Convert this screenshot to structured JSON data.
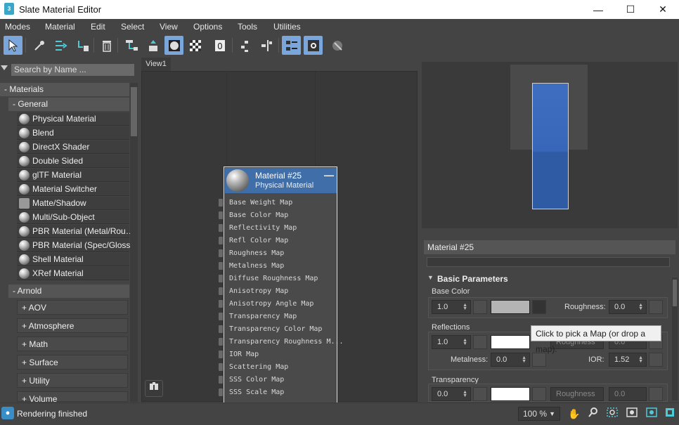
{
  "window": {
    "title": "Slate Material Editor",
    "app_icon": "3",
    "minimize": "—",
    "maximize": "☐",
    "close": "✕"
  },
  "menu": [
    "Modes",
    "Material",
    "Edit",
    "Select",
    "View",
    "Options",
    "Tools",
    "Utilities"
  ],
  "search": {
    "placeholder": "Search by Name ..."
  },
  "browser": {
    "materials_header": "- Materials",
    "general_header": "- General",
    "general_items": [
      "Physical Material",
      "Blend",
      "DirectX Shader",
      "Double Sided",
      "glTF Material",
      "Material Switcher",
      "Matte/Shadow",
      "Multi/Sub-Object",
      "PBR Material (Metal/Rou…",
      "PBR Material (Spec/Gloss)",
      "Shell Material",
      "XRef Material"
    ],
    "arnold_header": "- Arnold",
    "arnold_subcats": [
      "+ AOV",
      "+ Atmosphere",
      "+ Math",
      "+ Surface",
      "+ Utility",
      "+ Volume"
    ]
  },
  "view": {
    "tab": "View1"
  },
  "node": {
    "title": "Material #25",
    "subtitle": "Physical Material",
    "minimize": "—",
    "slots": [
      "Base Weight Map",
      "Base Color Map",
      "Reflectivity Map",
      "Refl Color Map",
      "Roughness Map",
      "Metalness Map",
      "Diffuse Roughness Map",
      "Anisotropy Map",
      "Anisotropy Angle Map",
      "Transparency Map",
      "Transparency Color Map",
      "Transparency Roughness M...",
      "IOR Map",
      "Scattering Map",
      "SSS Color Map",
      "SSS Scale Map"
    ]
  },
  "params": {
    "material_name": "Material #25",
    "section": "Basic Parameters",
    "base_color": {
      "label": "Base Color",
      "weight": "1.0",
      "roughness_label": "Roughness:",
      "roughness": "0.0",
      "swatch": "#b4b4b4"
    },
    "reflections": {
      "label": "Reflections",
      "weight": "1.0",
      "mode": "Roughness",
      "roughness": "0.0",
      "metalness_label": "Metalness:",
      "metalness": "0.0",
      "ior_label": "IOR:",
      "ior": "1.52",
      "swatch": "#ffffff"
    },
    "transparency": {
      "label": "Transparency",
      "weight": "0.0",
      "mode": "Roughness",
      "value": "0.0",
      "swatch": "#ffffff"
    },
    "tooltip": "Click to pick a Map (or drop a map)."
  },
  "status": {
    "text": "Rendering finished",
    "zoom": "100 %"
  }
}
